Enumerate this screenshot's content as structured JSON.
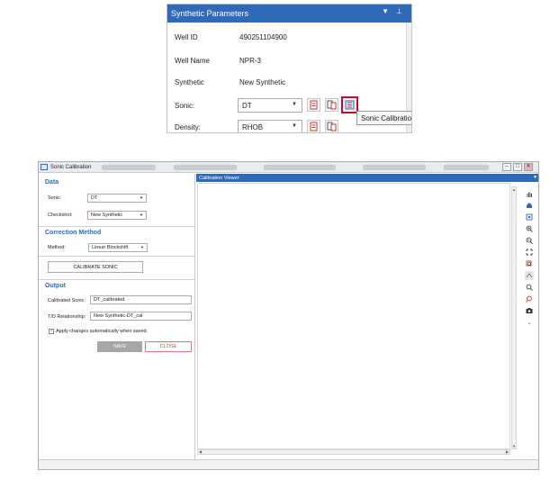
{
  "synthetic_panel": {
    "title": "Synthetic Parameters",
    "title_buttons": [
      "▼",
      "⊥"
    ],
    "well_id_label": "Well ID",
    "well_id_value": "490251104900",
    "well_name_label": "Well Name",
    "well_name_value": "NPR-3",
    "synthetic_label": "Synthetic",
    "synthetic_value": "New Synthetic",
    "sonic_label": "Sonic:",
    "sonic_value": "DT",
    "density_label": "Density:",
    "density_value": "RHOB",
    "tooltip": "Sonic Calibration",
    "accent_color": "#2e6ab7",
    "highlight_color": "#d6001c"
  },
  "sonic_calibration": {
    "window_title": "Sonic Calibration",
    "window_buttons": [
      "–",
      "□",
      "✕"
    ],
    "data": {
      "header": "Data",
      "sonic_label": "Sonic:",
      "sonic_value": "DT",
      "checkshot_label": "Checkshot:",
      "checkshot_value": "New Synthetic"
    },
    "correction": {
      "header": "Correction Method",
      "method_label": "Method:",
      "method_value": "Linear Blockshift"
    },
    "calibrate_button": "CALIBRATE SONIC",
    "output": {
      "header": "Output",
      "calibrated_sonic_label": "Calibrated Sonic:",
      "calibrated_sonic_value": "DT_calibrated",
      "td_relationship_label": "T/D Relationship:",
      "td_relationship_value": "New Synthetic-DT_cal",
      "apply_checkbox_label": "Apply changes automatically when saved.",
      "apply_checked": true
    },
    "save_button": "SAVE",
    "close_button": "CLOSE",
    "viewer": {
      "title": "Calibration Viewer",
      "tools": [
        "hand-icon",
        "home-icon",
        "zoom-extent-icon",
        "zoom-in-icon",
        "zoom-out-icon",
        "fit-icon",
        "zoom-region-icon",
        "pan-icon",
        "search-icon",
        "find-icon",
        "camera-icon",
        "more-icon"
      ]
    }
  }
}
